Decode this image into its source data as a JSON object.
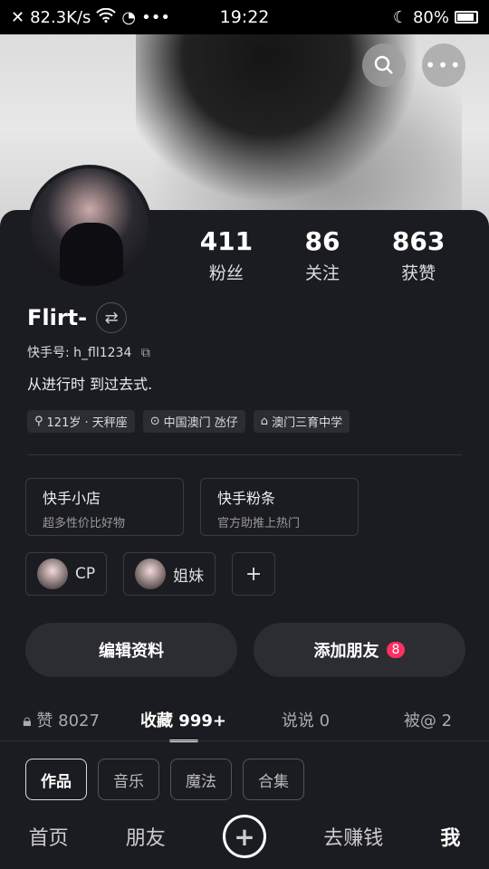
{
  "status": {
    "net_speed": "82.3K/s",
    "time": "19:22",
    "battery": "80%"
  },
  "header": {
    "search_icon": "search-icon",
    "more_icon": "more-dots-icon"
  },
  "profile": {
    "stats": [
      {
        "value": "411",
        "label": "粉丝"
      },
      {
        "value": "86",
        "label": "关注"
      },
      {
        "value": "863",
        "label": "获赞"
      }
    ],
    "name": "Flirt-",
    "kuaishou_id": "快手号: h_fll1234",
    "bio": "从进行时 到过去式.",
    "tags": [
      "121岁 · 天秤座",
      "中国澳门 氹仔",
      "澳门三育中学"
    ]
  },
  "shops": [
    {
      "title": "快手小店",
      "subtitle": "超多性价比好物"
    },
    {
      "title": "快手粉条",
      "subtitle": "官方助推上热门"
    }
  ],
  "relations": [
    {
      "label": "CP"
    },
    {
      "label": "姐妹"
    }
  ],
  "actions": {
    "edit": "编辑资料",
    "add_friend": "添加朋友",
    "add_friend_badge": "8"
  },
  "tabs": [
    "赞 8027",
    "收藏 999+",
    "说说 0",
    "被@ 2"
  ],
  "chips": [
    "作品",
    "音乐",
    "魔法",
    "合集"
  ],
  "bottom_nav": {
    "home": "首页",
    "friends": "朋友",
    "earn": "去赚钱",
    "me": "我"
  }
}
